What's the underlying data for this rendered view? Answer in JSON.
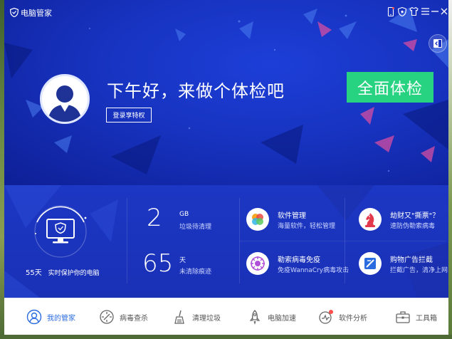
{
  "window": {
    "title": "电脑管家"
  },
  "header": {
    "greeting": "下午好，来做个体检吧",
    "login_label": "登录享特权",
    "check_label": "全面体检"
  },
  "protection": {
    "days": "55天",
    "label": "实时保护你的电脑"
  },
  "stats": [
    {
      "value": "2",
      "unit": "GB",
      "desc": "垃圾待清理"
    },
    {
      "value": "65",
      "unit": "天",
      "desc": "未清除痕迹"
    }
  ],
  "features": [
    {
      "title": "软件管理",
      "desc": "海量软件，轻松管理",
      "icon": "software-manager-icon"
    },
    {
      "title": "劫财又\"撕票\"？",
      "desc": "速防伪勒索病毒",
      "icon": "chess-knight-icon"
    },
    {
      "title": "勒索病毒免疫",
      "desc": "免疫WannaCry病毒攻击",
      "icon": "virus-immune-icon"
    },
    {
      "title": "购物广告拦截",
      "desc": "拦截广告，清净上网",
      "icon": "ad-block-icon"
    }
  ],
  "nav": [
    {
      "label": "我的管家",
      "active": true,
      "icon": "butler-icon"
    },
    {
      "label": "病毒查杀",
      "active": false,
      "icon": "virus-scan-icon"
    },
    {
      "label": "清理垃圾",
      "active": false,
      "icon": "broom-icon"
    },
    {
      "label": "电脑加速",
      "active": false,
      "icon": "rocket-icon"
    },
    {
      "label": "软件分析",
      "active": false,
      "icon": "analysis-icon"
    },
    {
      "label": "工具箱",
      "active": false,
      "icon": "toolbox-icon"
    }
  ],
  "colors": {
    "primary_blue": "#1a34c2",
    "accent_green": "#27d280",
    "nav_active": "#2a6be0"
  }
}
